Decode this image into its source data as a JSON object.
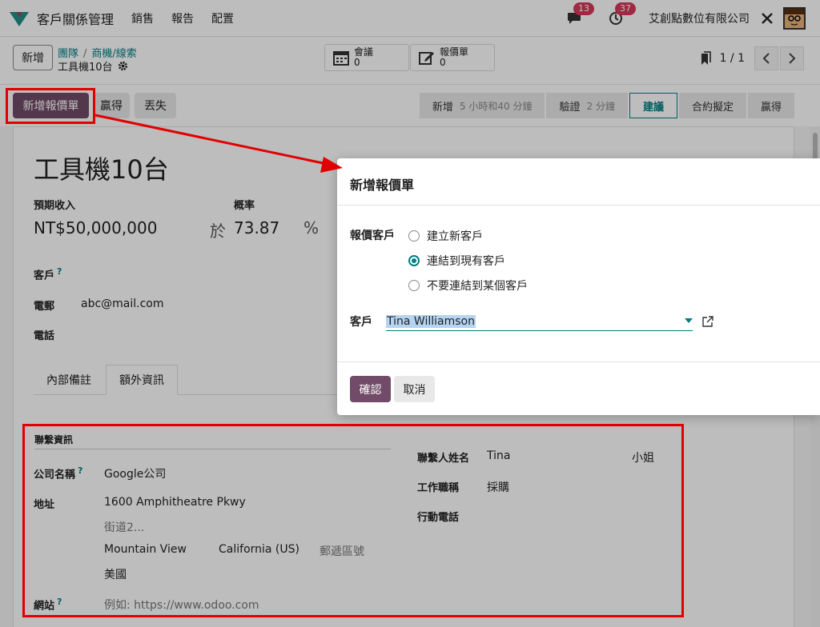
{
  "navbar": {
    "app_title": "客戶關係管理",
    "menu": [
      "銷售",
      "報告",
      "配置"
    ],
    "messages_badge": "13",
    "activities_badge": "37",
    "company": "艾創點數位有限公司"
  },
  "control": {
    "new_button": "新增",
    "breadcrumb": [
      "團隊",
      "商機/線索"
    ],
    "record_title": "工具機10台",
    "smart_buttons": [
      {
        "label": "會議",
        "value": "0",
        "icon": "calendar-icon"
      },
      {
        "label": "報價單",
        "value": "0",
        "icon": "edit-icon"
      }
    ],
    "pager": "1 / 1"
  },
  "statusbar": {
    "new_quotation": "新增報價單",
    "won": "贏得",
    "lost": "丟失",
    "stages": [
      {
        "name": "新增",
        "duration": "5 小時和40 分鐘"
      },
      {
        "name": "驗證",
        "duration": "2 分鐘"
      },
      {
        "name": "建議",
        "duration": ""
      },
      {
        "name": "合約擬定",
        "duration": ""
      },
      {
        "name": "贏得",
        "duration": ""
      }
    ]
  },
  "form": {
    "title": "工具機10台",
    "expected_revenue_label": "預期收入",
    "expected_revenue": "NT$50,000,000",
    "probability_label": "概率",
    "probability_prefix": "於",
    "probability": "73.87",
    "probability_unit": "%",
    "customer_label": "客戶",
    "customer_help": "?",
    "email_label": "電郵",
    "email": "abc@mail.com",
    "phone_label": "電話",
    "tabs": [
      "內部備註",
      "額外資訊"
    ],
    "contact_section": "聯繫資訊",
    "company_name_label": "公司名稱",
    "company_name": "Google公司",
    "address_label": "地址",
    "street": "1600 Amphitheatre Pkwy",
    "street2_placeholder": "街道2...",
    "city": "Mountain View",
    "state": "California (US)",
    "zip_placeholder": "郵遞區號",
    "country": "美國",
    "website_label": "網站",
    "website_placeholder": "例如: https://www.odoo.com",
    "contact_name_label": "聯繫人姓名",
    "contact_name": "Tina",
    "title_value": "小姐",
    "job_label": "工作職稱",
    "job": "採購",
    "mobile_label": "行動電話"
  },
  "modal": {
    "title": "新增報價單",
    "quote_customer_label": "報價客戶",
    "options": [
      "建立新客戶",
      "連結到現有客戶",
      "不要連結到某個客戶"
    ],
    "customer_label": "客戶",
    "customer_value": "Tina Williamson",
    "confirm": "確認",
    "cancel": "取消"
  },
  "colors": {
    "primary": "#714b67",
    "accent": "#017e84",
    "highlight": "#e10000"
  }
}
